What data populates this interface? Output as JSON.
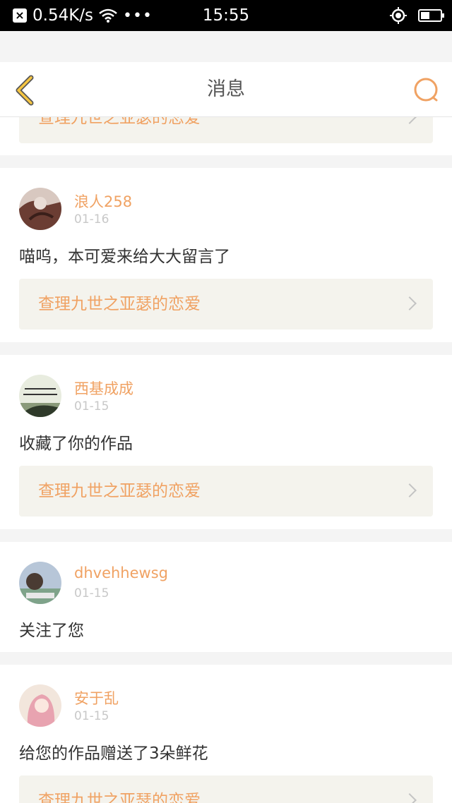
{
  "status_bar": {
    "x_label": "×",
    "speed": "0.54K/s",
    "dots": "•••",
    "time": "15:55",
    "battery_level": 0.45
  },
  "header": {
    "title": "消息",
    "back_icon": "back-chevron-icon",
    "search_icon": "search-icon"
  },
  "peek_item": {
    "work_title": "查理九世之亚瑟的恋爱"
  },
  "messages": [
    {
      "user": "浪人258",
      "date": "01-16",
      "text": "喵呜，本可爱来给大大留言了",
      "work_title": "查理九世之亚瑟的恋爱"
    },
    {
      "user": "西基成成",
      "date": "01-15",
      "text": "收藏了你的作品",
      "work_title": "查理九世之亚瑟的恋爱"
    },
    {
      "user": "dhvehhewsg",
      "date": "01-15",
      "text": "关注了您",
      "work_title": ""
    },
    {
      "user": "安于乱",
      "date": "01-15",
      "text": "给您的作品赠送了3朵鲜花",
      "work_title": "查理九世之亚瑟的恋爱"
    }
  ],
  "colors": {
    "accent": "#f0a263",
    "background": "#f4f4f4",
    "work_bg": "#f4f3ed",
    "back_icon_fill": "#f5c542"
  }
}
